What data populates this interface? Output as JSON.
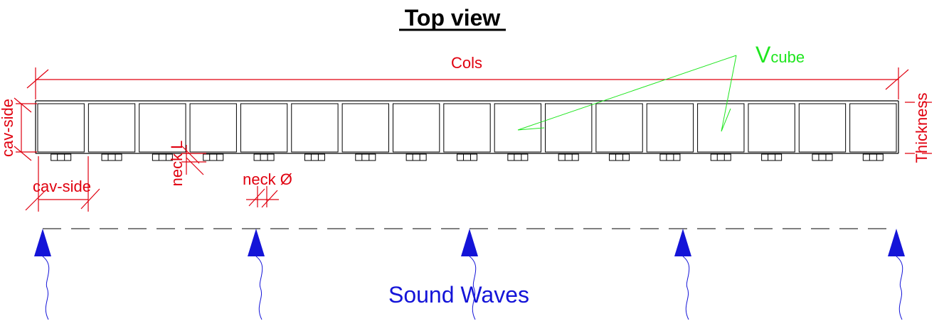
{
  "title": "Top view",
  "labels": {
    "cols": "Cols",
    "vcube_main": "V",
    "vcube_sub": "cube",
    "cav_side_vertical": "cav-side",
    "cav_side_horizontal": "cav-side",
    "neck_length": "neck L",
    "neck_diameter": "neck Ø",
    "thickness": "Thickness",
    "sound_waves": "Sound Waves"
  },
  "cavity_count": 17,
  "wave_sources": 5,
  "colors": {
    "dimension": "#e0000f",
    "volume_arrow": "#1ee61e",
    "sound": "#1414d8",
    "structure": "#000000"
  }
}
